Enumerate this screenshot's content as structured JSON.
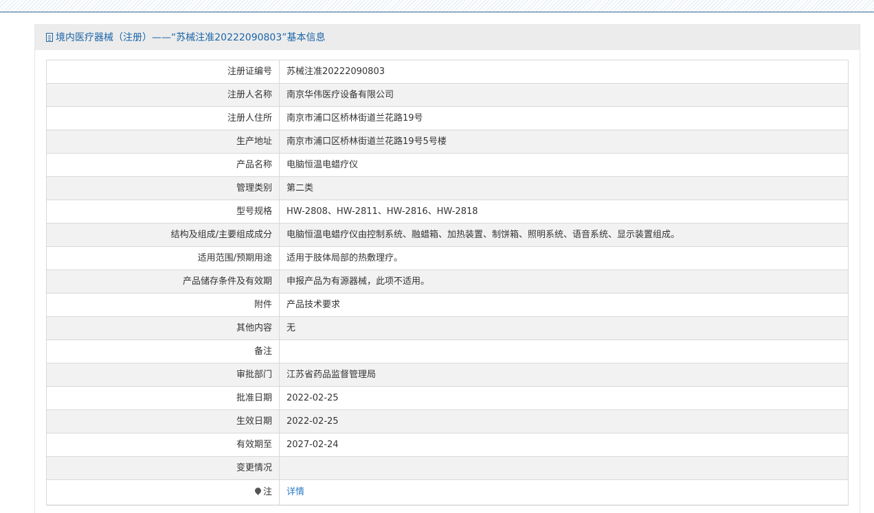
{
  "header": {
    "title": "境内医疗器械（注册）——“苏械注准20222090803”基本信息",
    "icon": "document-icon"
  },
  "rows": [
    {
      "label": "注册证编号",
      "value": "苏械注准20222090803"
    },
    {
      "label": "注册人名称",
      "value": "南京华伟医疗设备有限公司"
    },
    {
      "label": "注册人住所",
      "value": "南京市浦口区桥林街道兰花路19号"
    },
    {
      "label": "生产地址",
      "value": "南京市浦口区桥林街道兰花路19号5号楼"
    },
    {
      "label": "产品名称",
      "value": "电脑恒温电蜡疗仪"
    },
    {
      "label": "管理类别",
      "value": "第二类"
    },
    {
      "label": "型号规格",
      "value": "HW-2808、HW-2811、HW-2816、HW-2818"
    },
    {
      "label": "结构及组成/主要组成成分",
      "value": "电脑恒温电蜡疗仪由控制系统、融蜡箱、加热装置、制饼箱、照明系统、语音系统、显示装置组成。"
    },
    {
      "label": "适用范围/预期用途",
      "value": "适用于肢体局部的热敷理疗。"
    },
    {
      "label": "产品储存条件及有效期",
      "value": "申报产品为有源器械，此项不适用。"
    },
    {
      "label": "附件",
      "value": "产品技术要求"
    },
    {
      "label": "其他内容",
      "value": "无"
    },
    {
      "label": "备注",
      "value": ""
    },
    {
      "label": "审批部门",
      "value": "江苏省药品监督管理局"
    },
    {
      "label": "批准日期",
      "value": "2022-02-25"
    },
    {
      "label": "生效日期",
      "value": "2022-02-25"
    },
    {
      "label": "有效期至",
      "value": "2027-02-24"
    },
    {
      "label": "变更情况",
      "value": ""
    }
  ],
  "note_row": {
    "label": "注",
    "link_label": "详情",
    "icon": "pin-icon"
  },
  "colors": {
    "accent": "#1a64a8",
    "link": "#2a7bc8",
    "header_bg": "#ececec",
    "row_alt_bg": "#f2f2f2",
    "border": "#d8d8d8"
  }
}
